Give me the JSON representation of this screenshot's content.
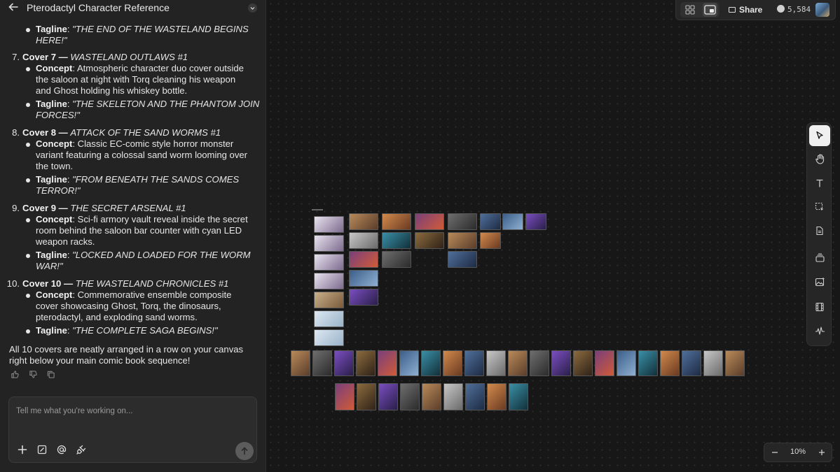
{
  "panel": {
    "title": "Pterodactyl Character Reference",
    "back_icon": "arrow-left-icon",
    "dropdown_icon": "chevron-down-icon"
  },
  "message": {
    "cover6_tagline_label": "Tagline",
    "cover6_tagline_line1": "\"THE END OF THE WASTELAND BEGINS",
    "cover6_tagline_line2": "HERE!\"",
    "covers": [
      {
        "num": "7.",
        "label": "Cover 7 —",
        "title": "WASTELAND OUTLAWS #1",
        "concept_label": "Concept",
        "concept_lines": [
          "Atmospheric character duo cover outside",
          "the saloon at night with Torq cleaning his weapon",
          "and Ghost holding his whiskey bottle."
        ],
        "tagline_label": "Tagline",
        "tagline_lines": [
          "\"THE SKELETON AND THE PHANTOM JOIN",
          "FORCES!\""
        ]
      },
      {
        "num": "8.",
        "label": "Cover 8 —",
        "title": "ATTACK OF THE SAND WORMS #1",
        "concept_label": "Concept",
        "concept_lines": [
          "Classic EC-comic style horror monster",
          "variant featuring a colossal sand worm looming over",
          "the town."
        ],
        "tagline_label": "Tagline",
        "tagline_lines": [
          "\"FROM BENEATH THE SANDS COMES",
          "TERROR!\""
        ]
      },
      {
        "num": "9.",
        "label": "Cover 9 —",
        "title": "THE SECRET ARSENAL #1",
        "concept_label": "Concept",
        "concept_lines": [
          "Sci-fi armory vault reveal inside the secret",
          "room behind the saloon bar counter with cyan LED",
          "weapon racks."
        ],
        "tagline_label": "Tagline",
        "tagline_lines": [
          "\"LOCKED AND LOADED FOR THE WORM",
          "WAR!\""
        ]
      },
      {
        "num": "10.",
        "label": "Cover 10 —",
        "title": "THE WASTELAND CHRONICLES #1",
        "concept_label": "Concept",
        "concept_lines": [
          "Commemorative ensemble composite",
          "cover showcasing Ghost, Torq, the dinosaurs,",
          "pterodactyl, and exploding sand worms."
        ],
        "tagline_label": "Tagline",
        "tagline_lines": [
          "\"THE COMPLETE SAGA BEGINS!\""
        ]
      }
    ],
    "closing_line1": "All 10 covers are neatly arranged in a row on your canvas",
    "closing_line2": "right below your main comic book sequence!"
  },
  "feedback": {
    "thumbs_up_icon": "thumbs-up-icon",
    "thumbs_down_icon": "thumbs-down-icon",
    "copy_icon": "copy-icon"
  },
  "composer": {
    "placeholder": "Tell me what you're working on..."
  },
  "topbar": {
    "share_label": "Share",
    "credits": "5,584"
  },
  "zoom": {
    "level": "10%"
  },
  "colors": {
    "panel_bg": "#232323",
    "canvas_bg": "#171717",
    "active_tool": "#f0f0f0"
  }
}
